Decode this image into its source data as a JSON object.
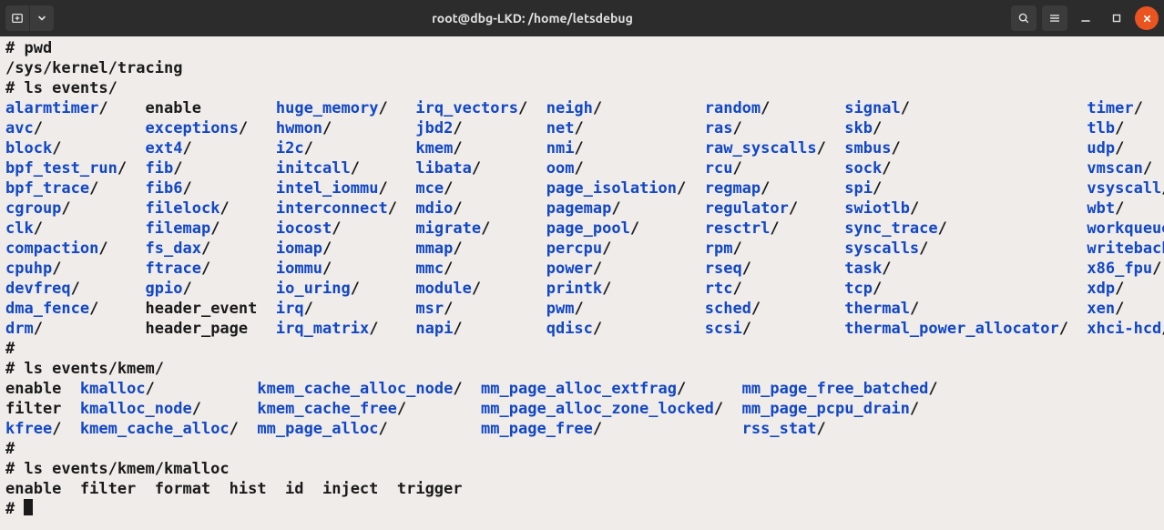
{
  "window": {
    "title": "root@dbg-LKD: /home/letsdebug"
  },
  "terminal": {
    "cmd_pwd": "# pwd",
    "pwd_out": "/sys/kernel/tracing",
    "cmd_ls_events": "# ls events/",
    "events_table": {
      "cols": [
        [
          {
            "t": "alarmtimer",
            "d": true
          },
          {
            "t": "avc",
            "d": true
          },
          {
            "t": "block",
            "d": true
          },
          {
            "t": "bpf_test_run",
            "d": true
          },
          {
            "t": "bpf_trace",
            "d": true
          },
          {
            "t": "cgroup",
            "d": true
          },
          {
            "t": "clk",
            "d": true
          },
          {
            "t": "compaction",
            "d": true
          },
          {
            "t": "cpuhp",
            "d": true
          },
          {
            "t": "devfreq",
            "d": true
          },
          {
            "t": "dma_fence",
            "d": true
          },
          {
            "t": "drm",
            "d": true
          }
        ],
        [
          {
            "t": "enable",
            "d": false
          },
          {
            "t": "exceptions",
            "d": true
          },
          {
            "t": "ext4",
            "d": true
          },
          {
            "t": "fib",
            "d": true
          },
          {
            "t": "fib6",
            "d": true
          },
          {
            "t": "filelock",
            "d": true
          },
          {
            "t": "filemap",
            "d": true
          },
          {
            "t": "fs_dax",
            "d": true
          },
          {
            "t": "ftrace",
            "d": true
          },
          {
            "t": "gpio",
            "d": true
          },
          {
            "t": "header_event",
            "d": false
          },
          {
            "t": "header_page",
            "d": false
          }
        ],
        [
          {
            "t": "huge_memory",
            "d": true
          },
          {
            "t": "hwmon",
            "d": true
          },
          {
            "t": "i2c",
            "d": true
          },
          {
            "t": "initcall",
            "d": true
          },
          {
            "t": "intel_iommu",
            "d": true
          },
          {
            "t": "interconnect",
            "d": true
          },
          {
            "t": "iocost",
            "d": true
          },
          {
            "t": "iomap",
            "d": true
          },
          {
            "t": "iommu",
            "d": true
          },
          {
            "t": "io_uring",
            "d": true
          },
          {
            "t": "irq",
            "d": true
          },
          {
            "t": "irq_matrix",
            "d": true
          }
        ],
        [
          {
            "t": "irq_vectors",
            "d": true
          },
          {
            "t": "jbd2",
            "d": true
          },
          {
            "t": "kmem",
            "d": true
          },
          {
            "t": "libata",
            "d": true
          },
          {
            "t": "mce",
            "d": true
          },
          {
            "t": "mdio",
            "d": true
          },
          {
            "t": "migrate",
            "d": true
          },
          {
            "t": "mmap",
            "d": true
          },
          {
            "t": "mmc",
            "d": true
          },
          {
            "t": "module",
            "d": true
          },
          {
            "t": "msr",
            "d": true
          },
          {
            "t": "napi",
            "d": true
          }
        ],
        [
          {
            "t": "neigh",
            "d": true
          },
          {
            "t": "net",
            "d": true
          },
          {
            "t": "nmi",
            "d": true
          },
          {
            "t": "oom",
            "d": true
          },
          {
            "t": "page_isolation",
            "d": true
          },
          {
            "t": "pagemap",
            "d": true
          },
          {
            "t": "page_pool",
            "d": true
          },
          {
            "t": "percpu",
            "d": true
          },
          {
            "t": "power",
            "d": true
          },
          {
            "t": "printk",
            "d": true
          },
          {
            "t": "pwm",
            "d": true
          },
          {
            "t": "qdisc",
            "d": true
          }
        ],
        [
          {
            "t": "random",
            "d": true
          },
          {
            "t": "ras",
            "d": true
          },
          {
            "t": "raw_syscalls",
            "d": true
          },
          {
            "t": "rcu",
            "d": true
          },
          {
            "t": "regmap",
            "d": true
          },
          {
            "t": "regulator",
            "d": true
          },
          {
            "t": "resctrl",
            "d": true
          },
          {
            "t": "rpm",
            "d": true
          },
          {
            "t": "rseq",
            "d": true
          },
          {
            "t": "rtc",
            "d": true
          },
          {
            "t": "sched",
            "d": true
          },
          {
            "t": "scsi",
            "d": true
          }
        ],
        [
          {
            "t": "signal",
            "d": true
          },
          {
            "t": "skb",
            "d": true
          },
          {
            "t": "smbus",
            "d": true
          },
          {
            "t": "sock",
            "d": true
          },
          {
            "t": "spi",
            "d": true
          },
          {
            "t": "swiotlb",
            "d": true
          },
          {
            "t": "sync_trace",
            "d": true
          },
          {
            "t": "syscalls",
            "d": true
          },
          {
            "t": "task",
            "d": true
          },
          {
            "t": "tcp",
            "d": true
          },
          {
            "t": "thermal",
            "d": true
          },
          {
            "t": "thermal_power_allocator",
            "d": true
          }
        ],
        [
          {
            "t": "timer",
            "d": true
          },
          {
            "t": "tlb",
            "d": true
          },
          {
            "t": "udp",
            "d": true
          },
          {
            "t": "vmscan",
            "d": true
          },
          {
            "t": "vsyscall",
            "d": true
          },
          {
            "t": "wbt",
            "d": true
          },
          {
            "t": "workqueue",
            "d": true
          },
          {
            "t": "writeback",
            "d": true
          },
          {
            "t": "x86_fpu",
            "d": true
          },
          {
            "t": "xdp",
            "d": true
          },
          {
            "t": "xen",
            "d": true
          },
          {
            "t": "xhci-hcd",
            "d": true
          }
        ]
      ],
      "col_starts": [
        0,
        15,
        29,
        44,
        58,
        75,
        90,
        116
      ]
    },
    "hash1": "#",
    "cmd_ls_kmem": "# ls events/kmem/",
    "kmem_table": {
      "cols": [
        [
          {
            "t": "enable",
            "d": false
          },
          {
            "t": "filter",
            "d": false
          },
          {
            "t": "kfree",
            "d": true
          }
        ],
        [
          {
            "t": "kmalloc",
            "d": true
          },
          {
            "t": "kmalloc_node",
            "d": true
          },
          {
            "t": "kmem_cache_alloc",
            "d": true
          }
        ],
        [
          {
            "t": "kmem_cache_alloc_node",
            "d": true
          },
          {
            "t": "kmem_cache_free",
            "d": true
          },
          {
            "t": "mm_page_alloc",
            "d": true
          }
        ],
        [
          {
            "t": "mm_page_alloc_extfrag",
            "d": true
          },
          {
            "t": "mm_page_alloc_zone_locked",
            "d": true
          },
          {
            "t": "mm_page_free",
            "d": true
          }
        ],
        [
          {
            "t": "mm_page_free_batched",
            "d": true
          },
          {
            "t": "mm_page_pcpu_drain",
            "d": true
          },
          {
            "t": "rss_stat",
            "d": true
          }
        ]
      ],
      "col_starts": [
        0,
        8,
        27,
        51,
        79
      ]
    },
    "hash2": "#",
    "cmd_ls_kmalloc": "# ls events/kmem/kmalloc",
    "kmalloc_line": "enable  filter  format  hist  id  inject  trigger",
    "final_prompt": "# "
  }
}
